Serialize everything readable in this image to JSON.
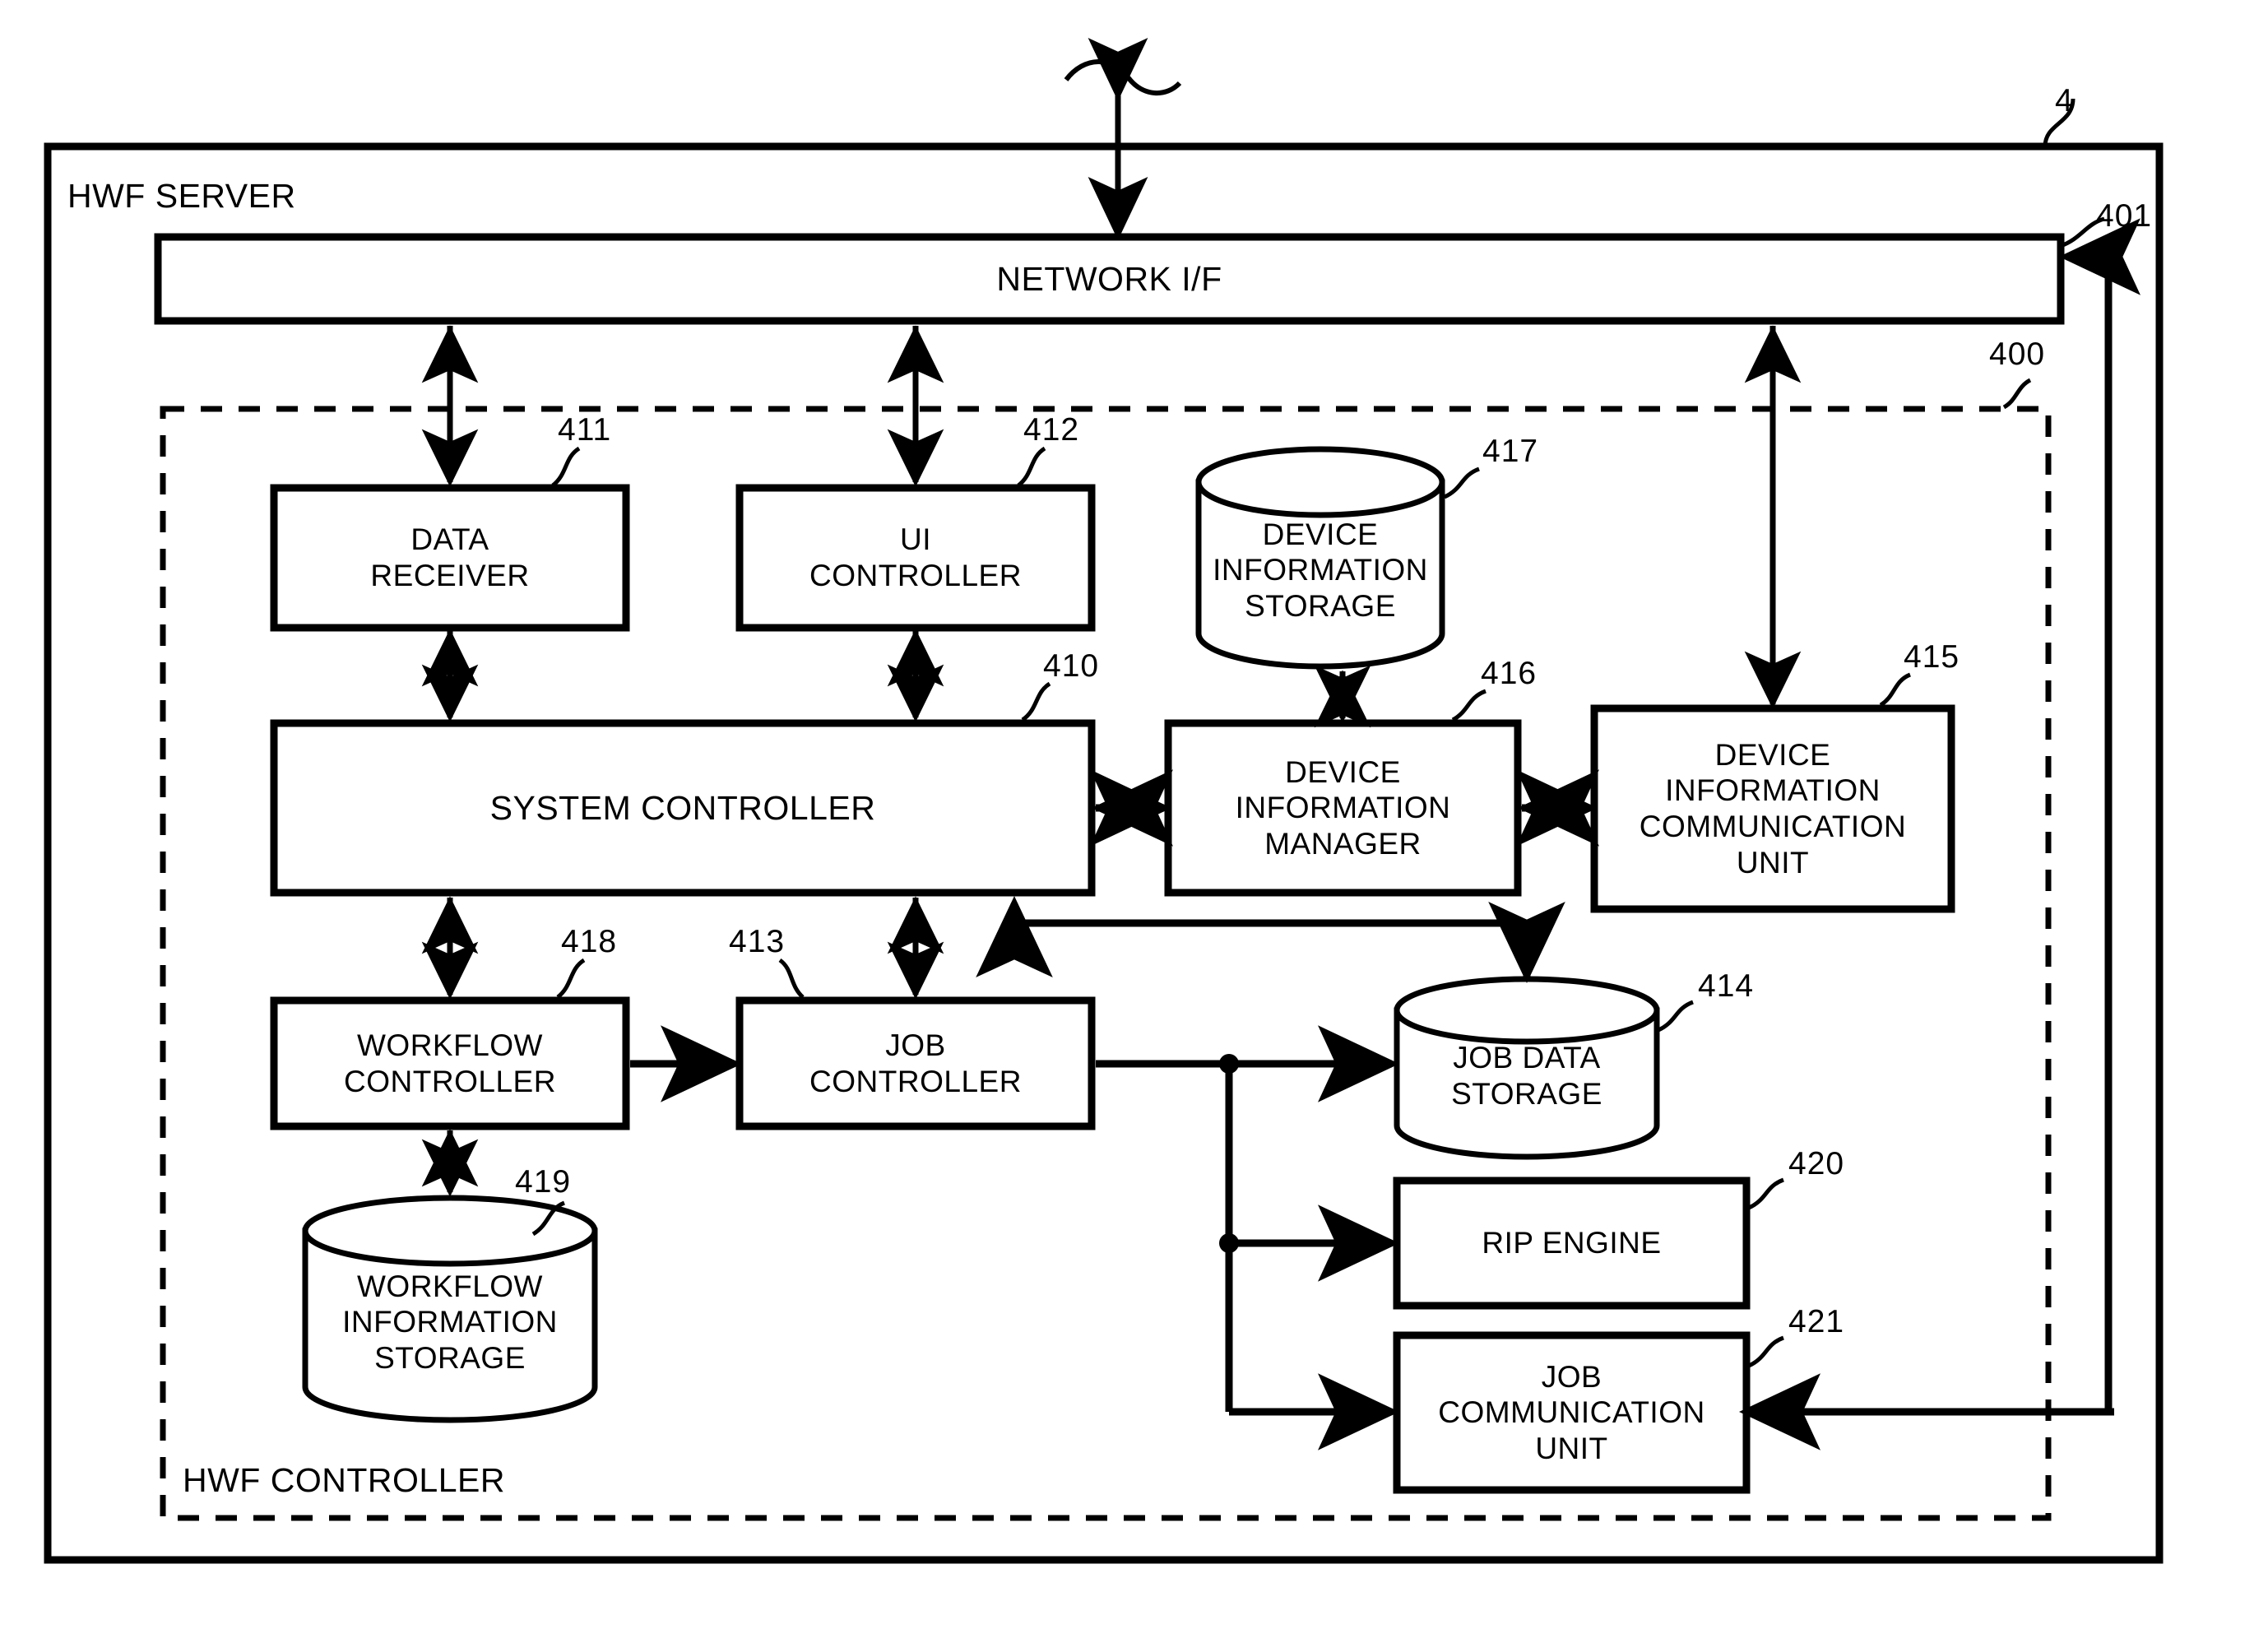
{
  "figure": {
    "outer_box_label": "HWF SERVER",
    "outer_ref": "4",
    "dashed_box_label": "HWF CONTROLLER",
    "dashed_box_ref": "400",
    "network_if": {
      "label": "NETWORK I/F",
      "ref": "401"
    }
  },
  "blocks": [
    {
      "id": "data_receiver",
      "label": "DATA\nRECEIVER",
      "ref": "411",
      "shape": "rect"
    },
    {
      "id": "ui_controller",
      "label": "UI\nCONTROLLER",
      "ref": "412",
      "shape": "rect"
    },
    {
      "id": "device_info_storage",
      "label": "DEVICE\nINFORMATION\nSTORAGE",
      "ref": "417",
      "shape": "cylinder"
    },
    {
      "id": "system_controller",
      "label": "SYSTEM CONTROLLER",
      "ref": "410",
      "shape": "rect"
    },
    {
      "id": "device_info_manager",
      "label": "DEVICE\nINFORMATION\nMANAGER",
      "ref": "416",
      "shape": "rect"
    },
    {
      "id": "device_info_comm",
      "label": "DEVICE\nINFORMATION\nCOMMUNICATION\nUNIT",
      "ref": "415",
      "shape": "rect"
    },
    {
      "id": "workflow_controller",
      "label": "WORKFLOW\nCONTROLLER",
      "ref": "418",
      "shape": "rect"
    },
    {
      "id": "job_controller",
      "label": "JOB\nCONTROLLER",
      "ref": "413",
      "shape": "rect"
    },
    {
      "id": "workflow_info_storage",
      "label": "WORKFLOW\nINFORMATION\nSTORAGE",
      "ref": "419",
      "shape": "cylinder"
    },
    {
      "id": "job_data_storage",
      "label": "JOB DATA\nSTORAGE",
      "ref": "414",
      "shape": "cylinder"
    },
    {
      "id": "rip_engine",
      "label": "RIP ENGINE",
      "ref": "420",
      "shape": "rect"
    },
    {
      "id": "job_comm_unit",
      "label": "JOB\nCOMMUNICATION\nUNIT",
      "ref": "421",
      "shape": "rect"
    }
  ],
  "colors": {
    "stroke": "#000000",
    "fill": "#ffffff"
  }
}
